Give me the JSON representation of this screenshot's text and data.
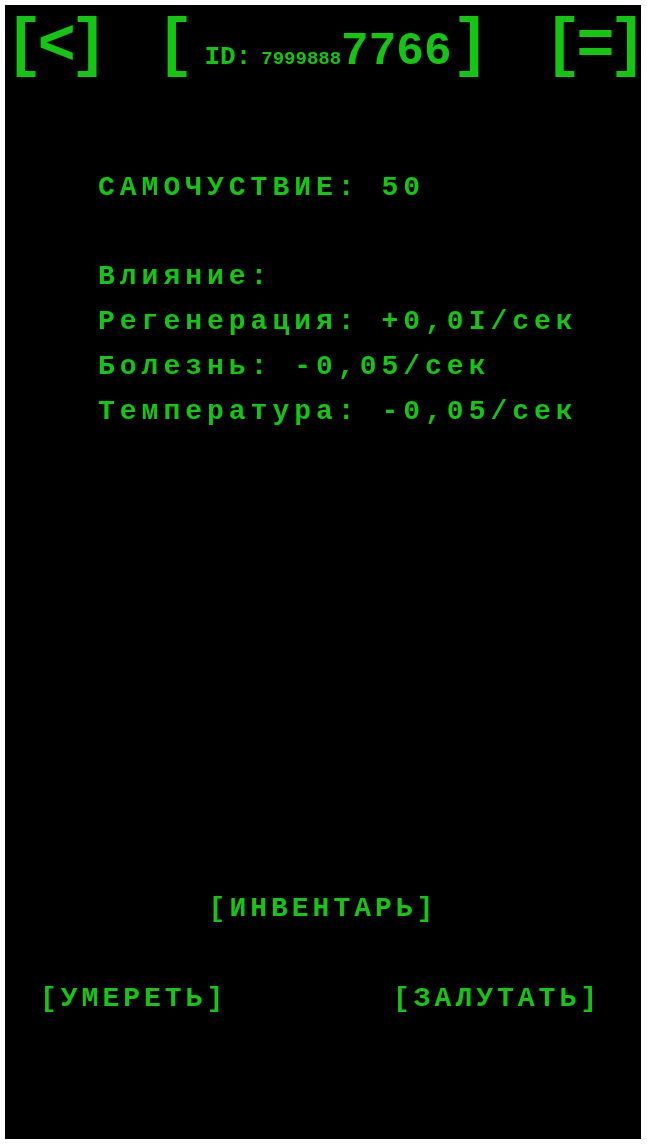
{
  "header": {
    "back_button": "[<]",
    "id_button": {
      "open": "[",
      "label": "ID:",
      "prefix": "7999888",
      "suffix": "7766",
      "close": "]"
    },
    "menu_button": "[=]"
  },
  "wellbeing": "САМОЧУСТВИЕ: 50",
  "effects": {
    "title": "Влияние:",
    "items": [
      "Регенерация: +0,0I/сек",
      "Болезнь: -0,05/сек",
      "Температура: -0,05/сек"
    ]
  },
  "inventory_button": "[ИНВЕНТАРЬ]",
  "actions": [
    "[УМЕРЕТЬ]",
    "[ЗАЛУТАТЬ]"
  ]
}
